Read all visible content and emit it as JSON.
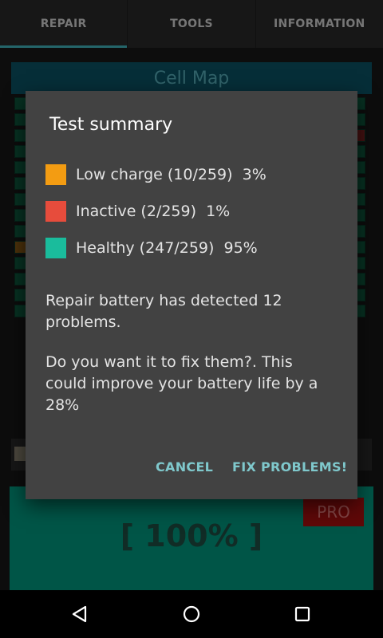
{
  "tabs": [
    {
      "label": "REPAIR",
      "active": true
    },
    {
      "label": "TOOLS",
      "active": false
    },
    {
      "label": "INFORMATION",
      "active": false
    }
  ],
  "background": {
    "cell_map_title": "Cell Map",
    "pro_label": "PRO",
    "charge_percent": "[ 100% ]"
  },
  "dialog": {
    "title": "Test summary",
    "legend": [
      {
        "color": "#f39c12",
        "text": "Low charge (10/259)  3%"
      },
      {
        "color": "#e74c3c",
        "text": "Inactive (2/259)  1%"
      },
      {
        "color": "#1abc9c",
        "text": "Healthy (247/259)  95%"
      }
    ],
    "message_1": "Repair battery has detected 12 problems.",
    "message_2": "Do you want it to fix them?. This could improve your battery life by a 28%",
    "cancel_label": "CANCEL",
    "fix_label": "FIX PROBLEMS!"
  },
  "nav": {
    "back_icon": "back-triangle-icon",
    "home_icon": "home-circle-icon",
    "recents_icon": "recents-square-icon"
  },
  "colors": {
    "accent": "#43b9c2",
    "dialog_bg": "#424242",
    "low_charge": "#f39c12",
    "inactive": "#e74c3c",
    "healthy": "#1abc9c"
  }
}
